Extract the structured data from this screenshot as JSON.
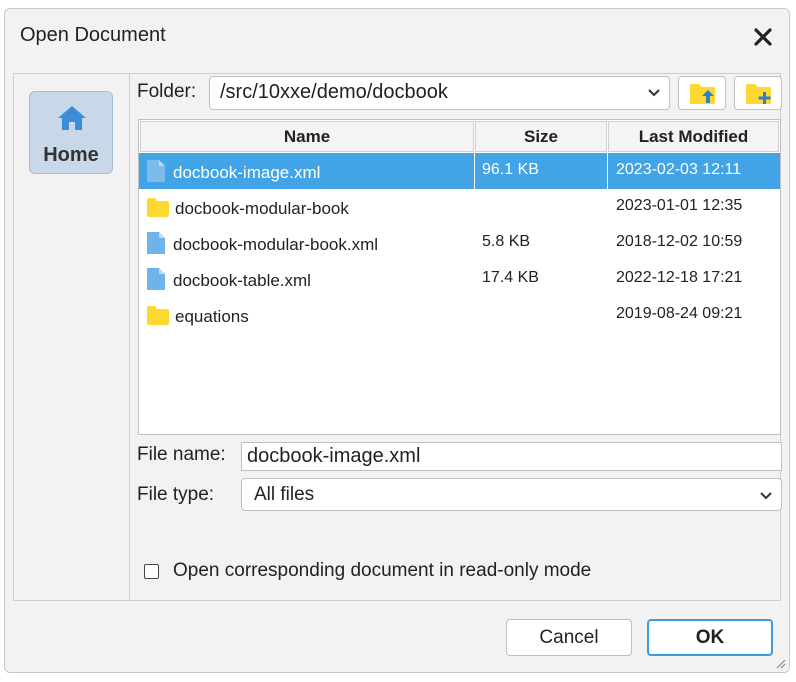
{
  "dialog": {
    "title": "Open Document",
    "close_icon": "close-icon"
  },
  "sidebar": {
    "home_label": "Home",
    "home_icon": "home-icon"
  },
  "folder": {
    "label": "Folder:",
    "path": "/src/10xxe/demo/docbook",
    "up_icon": "folder-up-icon",
    "new_icon": "new-folder-icon"
  },
  "table": {
    "headers": {
      "name": "Name",
      "size": "Size",
      "modified": "Last Modified"
    },
    "rows": [
      {
        "type": "file",
        "name": "docbook-image.xml",
        "size": "96.1 KB",
        "modified": "2023-02-03 12:11",
        "selected": true
      },
      {
        "type": "folder",
        "name": "docbook-modular-book",
        "size": "",
        "modified": "2023-01-01 12:35",
        "selected": false
      },
      {
        "type": "file",
        "name": "docbook-modular-book.xml",
        "size": "5.8 KB",
        "modified": "2018-12-02 10:59",
        "selected": false
      },
      {
        "type": "file",
        "name": "docbook-table.xml",
        "size": "17.4 KB",
        "modified": "2022-12-18 17:21",
        "selected": false
      },
      {
        "type": "folder",
        "name": "equations",
        "size": "",
        "modified": "2019-08-24 09:21",
        "selected": false
      }
    ]
  },
  "file_name": {
    "label": "File name:",
    "value": "docbook-image.xml"
  },
  "file_type": {
    "label": "File type:",
    "value": "All files"
  },
  "readonly": {
    "label": "Open corresponding document in read-only mode",
    "checked": false
  },
  "buttons": {
    "cancel": "Cancel",
    "ok": "OK"
  },
  "colors": {
    "selection": "#42a4e6",
    "folder": "#fcd830",
    "file": "#6fb3ea",
    "accent": "#3c9ae0"
  }
}
